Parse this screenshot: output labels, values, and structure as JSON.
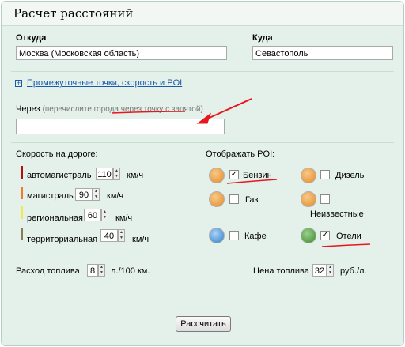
{
  "title": "Расчет расстояний",
  "from": {
    "label": "Откуда",
    "value": "Москва (Московская область)"
  },
  "to": {
    "label": "Куда",
    "value": "Севастополь"
  },
  "expand_link": "Промежуточные точки, скорость и POI",
  "via": {
    "label": "Через",
    "hint_prefix": "(перечислите города ",
    "hint_emph": "через точку с запятой",
    "hint_suffix": ")",
    "value": ""
  },
  "speed": {
    "title": "Скорость на дороге:",
    "unit": "км/ч",
    "roads": [
      {
        "label": "автомагистраль",
        "value": "110",
        "color": "#b40e0e"
      },
      {
        "label": "магистраль",
        "value": "90",
        "color": "#f07a2a"
      },
      {
        "label": "региональная",
        "value": "60",
        "color": "#f6e84a"
      },
      {
        "label": "территориальная",
        "value": "40",
        "color": "#8a7a5a"
      }
    ]
  },
  "poi": {
    "title": "Отображать POI:",
    "items": [
      {
        "label": "Бензин",
        "checked": true,
        "check_glyph": "✓",
        "icon": "fuel-pump-icon",
        "color": "#e58a25"
      },
      {
        "label": "Дизель",
        "checked": false,
        "check_glyph": "",
        "icon": "fuel-pump-icon",
        "color": "#e58a25"
      },
      {
        "label": "Газ",
        "checked": false,
        "check_glyph": "",
        "icon": "gas-station-icon",
        "color": "#e58a25"
      },
      {
        "label": "Неизвестные",
        "checked": false,
        "check_glyph": "",
        "icon": "fuel-pump-icon",
        "color": "#e58a25"
      },
      {
        "label": "Кафе",
        "checked": false,
        "check_glyph": "",
        "icon": "cafe-cup-icon",
        "color": "#2f7fc9"
      },
      {
        "label": "Отели",
        "checked": true,
        "check_glyph": "✓",
        "icon": "hotel-bed-icon",
        "color": "#3a8c2f"
      }
    ]
  },
  "fuel": {
    "label": "Расход топлива",
    "value": "8",
    "unit": "л./100 км."
  },
  "price": {
    "label": "Цена топлива",
    "value": "32",
    "unit": "руб./л."
  },
  "submit": "Рассчитать",
  "colors": {
    "annotation_red": "#e8161d",
    "link_blue": "#1a5aa8",
    "panel_bg": "#e4f0ea"
  }
}
